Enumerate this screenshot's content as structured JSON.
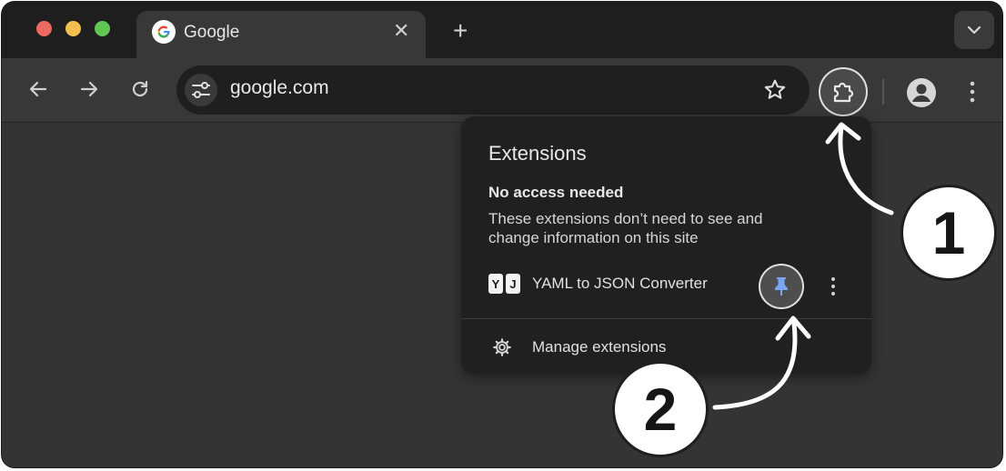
{
  "window": {
    "traffic_lights": {
      "close": "#ec6a5f",
      "minimize": "#f4bf4f",
      "maximize": "#61c554"
    }
  },
  "tabs": [
    {
      "title": "Google",
      "icon": "google-g-icon",
      "active": true
    }
  ],
  "toolbar": {
    "url": "google.com"
  },
  "extensions_popup": {
    "title": "Extensions",
    "section_title": "No access needed",
    "section_description": "These extensions don’t need to see and change information on this site",
    "extensions": [
      {
        "name": "YAML to JSON Converter",
        "logo_letters": [
          "Y",
          "J"
        ],
        "icon": "pin-icon",
        "pin_color": "#7aa6f5"
      }
    ],
    "manage_label": "Manage extensions"
  },
  "callouts": {
    "step1": "1",
    "step2": "2"
  }
}
